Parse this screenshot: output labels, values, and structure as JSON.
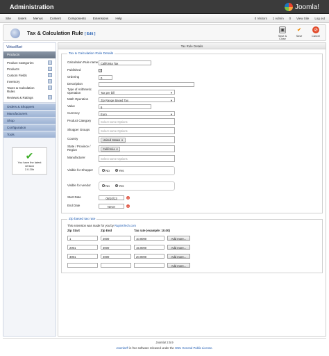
{
  "header": {
    "title": "Administration",
    "brand": "Joomla!"
  },
  "menubar": {
    "items": [
      "Site",
      "Users",
      "Menus",
      "Content",
      "Components",
      "Extensions",
      "Help"
    ],
    "visitors": "0 Visitors",
    "admins": "1 Admin",
    "messages": "0",
    "view_site": "View Site",
    "logout": "Log out"
  },
  "toolbar": {
    "title": "Tax & Calculation Rule",
    "edit_label": "[ Edit ]",
    "save_close": "Save & Close",
    "save": "Save",
    "cancel": "Cancel"
  },
  "sidebar": {
    "logo": "VirtueMart",
    "active_section": "Products",
    "sub_items": [
      "Product Categories",
      "Products",
      "Custom Fields",
      "Inventory",
      "Taxes & Calculation Rules",
      "Reviews & Ratings"
    ],
    "sections": [
      "Orders & Shoppers",
      "Manufacturers",
      "Shop",
      "Configuration",
      "Tools"
    ],
    "version_line1": "You have the latest",
    "version_line2": "version",
    "version_number": "2.0.20b"
  },
  "main": {
    "tab": "Tax Rule Details",
    "details_legend": "Tax & Calculation Rule Details",
    "labels": {
      "rule_name": "Calculation Rule name",
      "published": "Published",
      "ordering": "Ordering",
      "description": "Description",
      "arith": "Type of Arithmetic Operation",
      "math_op": "Math Operation",
      "value": "Value",
      "currency": "Currency",
      "product_category": "Product Category",
      "shopper_groups": "Shopper Groups",
      "country": "Country",
      "state": "State / Province / Region",
      "manufacturer": "Manufacturer",
      "visible_shopper": "Visible for Shopper",
      "visible_vendor": "Visible for vendor",
      "start_date": "Start Date",
      "end_date": "End Date"
    },
    "values": {
      "rule_name": "California Tax",
      "published_mark": "✓",
      "ordering": "0",
      "description": "",
      "arith": "Tax per bill",
      "math_op": "Zip Range Based Tax",
      "value": "6",
      "currency": "Euro",
      "product_category_placeholder": "Select some Options",
      "shopper_groups_placeholder": "Select some Options",
      "country_chip": "United States",
      "state_chip": "California",
      "manufacturer_placeholder": "Select some Options",
      "no": "No",
      "yes": "Yes",
      "start_date": "05/10/13",
      "end_date": "Never"
    },
    "zip": {
      "legend": "Zip based tax rate",
      "note_prefix": "This extension was made for you by",
      "note_link": "RupinsTech.com",
      "headers": [
        "Zip Start",
        "Zip End",
        "Tax rate (example: 10.00)"
      ],
      "rows": [
        [
          "1",
          "2000",
          "10.0000"
        ],
        [
          "2001",
          "3000",
          "15.0000"
        ],
        [
          "3001",
          "4000",
          "20.0000"
        ],
        [
          "",
          "",
          ""
        ]
      ],
      "add_label": "Add more..."
    }
  },
  "footer": {
    "version": "Joomla! 2.5.9",
    "link1": "Joomla!®",
    "text": "is free software released under the",
    "link2": "GNU General Public License."
  },
  "colors": {
    "topbar": "#3b3b3b",
    "sidebar_section": "#a9bcd9",
    "link": "#1a58b0",
    "cancel": "#e24a2a",
    "check": "#3fae2a"
  }
}
